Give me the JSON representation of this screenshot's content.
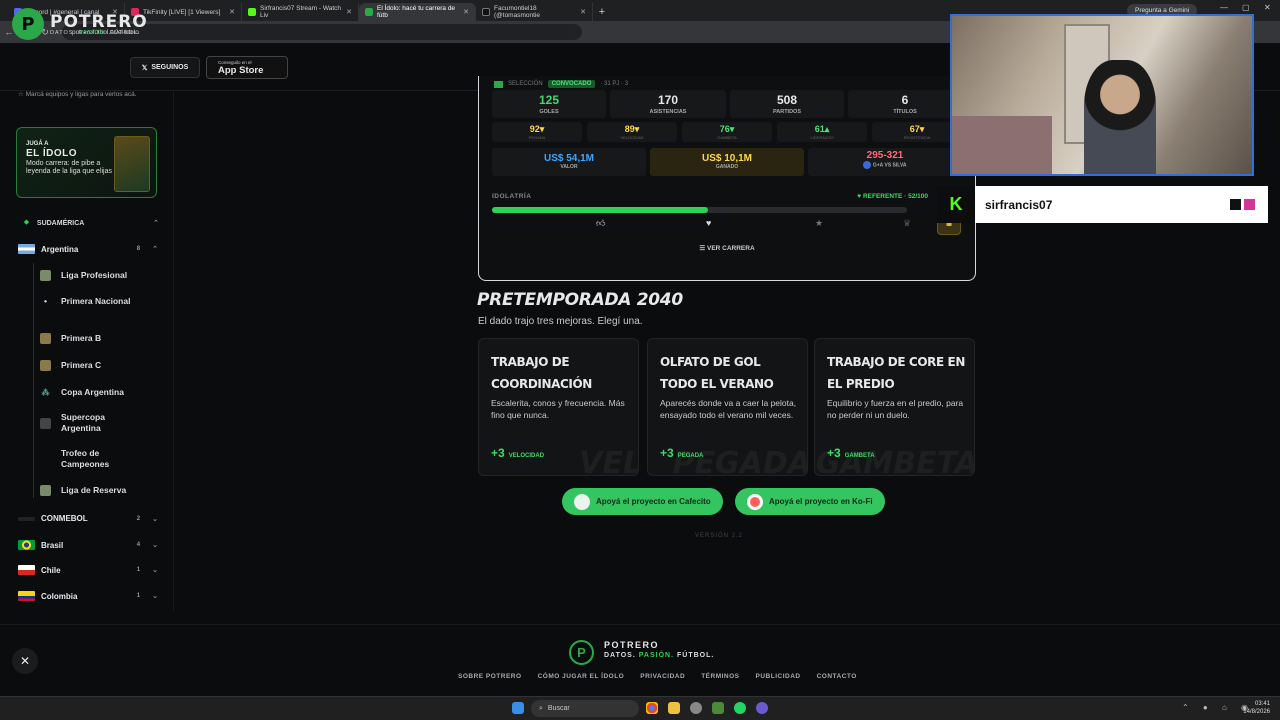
{
  "browser": {
    "tabs": [
      {
        "title": "Discord | #general | canal",
        "color": "#5865f2",
        "active": false
      },
      {
        "title": "TikFinity [LIVE] [1 Viewers]",
        "color": "#e0245e",
        "active": false
      },
      {
        "title": "Sirfrancis07 Stream - Watch Liv",
        "color": "#53fc18",
        "active": false
      },
      {
        "title": "El Ídolo: hacé tu carrera de fútb",
        "color": "#2aa84a",
        "active": true
      },
      {
        "title": "Facumontiel18 (@tomasmontie",
        "color": "#111111",
        "active": false
      }
    ],
    "gemini": "Pregunta a Gemini",
    "url": "potrerofutbol.ar/el-idolo"
  },
  "header": {
    "logo_name": "POTRERO",
    "tag_1": "DATOS.",
    "tag_2": "PASIÓN.",
    "tag_3": "FÚTBOL.",
    "follow_label": "SEGUINOS",
    "appstore_small": "Conseguilo en el",
    "appstore_big": "App Store"
  },
  "sidebar": {
    "hint": "Marcá equipos y ligas para verlos acá.",
    "promo": {
      "kicker": "JUGÁ A",
      "title": "EL ÍDOLO",
      "desc": "Modo carrera: de pibe a leyenda de la liga que elijas"
    },
    "region_sudamerica": "SUDAMÉRICA",
    "argentina": {
      "name": "Argentina",
      "count": "8"
    },
    "leagues": [
      "Liga Profesional",
      "Primera Nacional",
      "Primera B",
      "Primera C",
      "Copa Argentina",
      "Supercopa Argentina",
      "Trofeo de Campeones",
      "Liga de Reserva"
    ],
    "conmebol": {
      "name": "CONMEBOL",
      "count": "2"
    },
    "countries": [
      {
        "name": "Brasil",
        "count": "4"
      },
      {
        "name": "Chile",
        "count": "1"
      },
      {
        "name": "Colombia",
        "count": "1"
      }
    ]
  },
  "career": {
    "selection": "SELECCIÓN",
    "badge": "CONVOCADO",
    "sel_stats": "· 31 PJ · 3",
    "stats": [
      {
        "value": "125",
        "label": "GOLES"
      },
      {
        "value": "170",
        "label": "ASISTENCIAS"
      },
      {
        "value": "508",
        "label": "PARTIDOS"
      },
      {
        "value": "6",
        "label": "TÍTULOS"
      }
    ],
    "attrs": [
      {
        "value": "92▾",
        "label": "PEGADA",
        "color": "#ffd84a"
      },
      {
        "value": "89▾",
        "label": "VELOCIDAD",
        "color": "#ffd84a"
      },
      {
        "value": "76▾",
        "label": "GAMBETA",
        "color": "#4ee07a"
      },
      {
        "value": "61▴",
        "label": "LIDERAZGO",
        "color": "#4ee07a"
      },
      {
        "value": "67▾",
        "label": "RESISTENCIA",
        "color": "#ffd84a"
      }
    ],
    "valor": {
      "value": "US$ 54,1M",
      "label": "VALOR"
    },
    "ganado": {
      "value": "US$ 10,1M",
      "label": "GANADO"
    },
    "rival": {
      "value": "295-321",
      "label": "G+A VS SILVA"
    },
    "idolatria_label": "IDOLATRÍA",
    "referente": "REFERENTE · 52/100",
    "idolatria": 0.52,
    "ver_carrera": "VER CARRERA"
  },
  "pretemporada": {
    "title": "PRETEMPORADA 2040",
    "subtitle": "El dado trajo tres mejoras. Elegí una.",
    "options": [
      {
        "title": "TRABAJO DE COORDINACIÓN",
        "desc": "Escalerita, conos y frecuencia. Más fino que nunca.",
        "bonus": "+3",
        "attr": "VELOCIDAD",
        "wm": "VEL"
      },
      {
        "title": "OLFATO DE GOL TODO EL VERANO",
        "desc": "Aparecés donde va a caer la pelota, ensayado todo el verano mil veces.",
        "bonus": "+3",
        "attr": "PEGADA",
        "wm": "PEGADA"
      },
      {
        "title": "TRABAJO DE CORE EN EL PREDIO",
        "desc": "Equilibrio y fuerza en el predio, para no perder ni un duelo.",
        "bonus": "+3",
        "attr": "GAMBETA",
        "wm": "GAMBETA"
      }
    ]
  },
  "donate": {
    "cafecito": "Apoyá el proyecto en Cafecito",
    "kofi": "Apoyá el proyecto en Ko-Fi"
  },
  "version": "VERSIÓN 2.2",
  "footer": {
    "name": "POTRERO",
    "tag_1": "DATOS.",
    "tag_2": "PASIÓN.",
    "tag_3": "FÚTBOL.",
    "links": [
      "SOBRE POTRERO",
      "CÓMO JUGAR EL ÍDOLO",
      "PRIVACIDAD",
      "TÉRMINOS",
      "PUBLICIDAD",
      "CONTACTO"
    ]
  },
  "overlay": {
    "streamer": "sirfrancis07"
  },
  "taskbar": {
    "search": "Buscar",
    "time": "03:41",
    "date": "14/8/2026"
  }
}
